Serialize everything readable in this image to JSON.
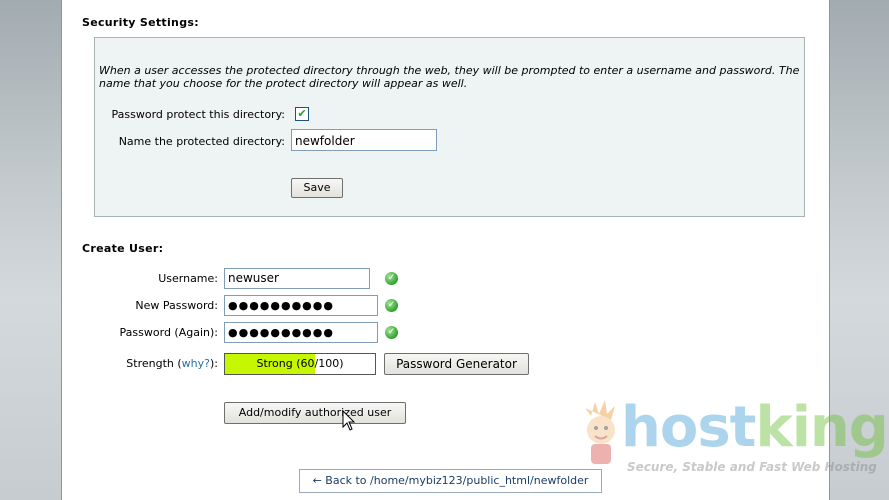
{
  "security": {
    "title": "Security Settings:",
    "description": "When a user accesses the protected directory through the web, they will be prompted to enter a username and password. The name that you choose for the protect directory will appear as well.",
    "protect_label": "Password protect this directory:",
    "protect_checked": "✔",
    "name_label": "Name the protected directory:",
    "name_value": "newfolder",
    "save_label": "Save"
  },
  "create_user": {
    "title": "Create User:",
    "username_label": "Username:",
    "username_value": "newuser",
    "new_password_label": "New Password:",
    "new_password_value": "●●●●●●●●●●",
    "password_again_label": "Password (Again):",
    "password_again_value": "●●●●●●●●●●",
    "strength_label_pre": "Strength (",
    "strength_why": "why?",
    "strength_label_post": "):",
    "strength_text": "Strength",
    "strength_text_label": "Strong (60/100)",
    "strength_value": 0.6,
    "generator_label": "Password Generator",
    "add_label": "Add/modify authorized user"
  },
  "back_link": "← Back to /home/mybiz123/public_html/newfolder",
  "logo": {
    "host": "host",
    "king": "king",
    "tagline": "Secure, Stable and Fast Web Hosting"
  },
  "colors": {
    "accent_green": "#c6f700",
    "link": "#2a6fad"
  }
}
